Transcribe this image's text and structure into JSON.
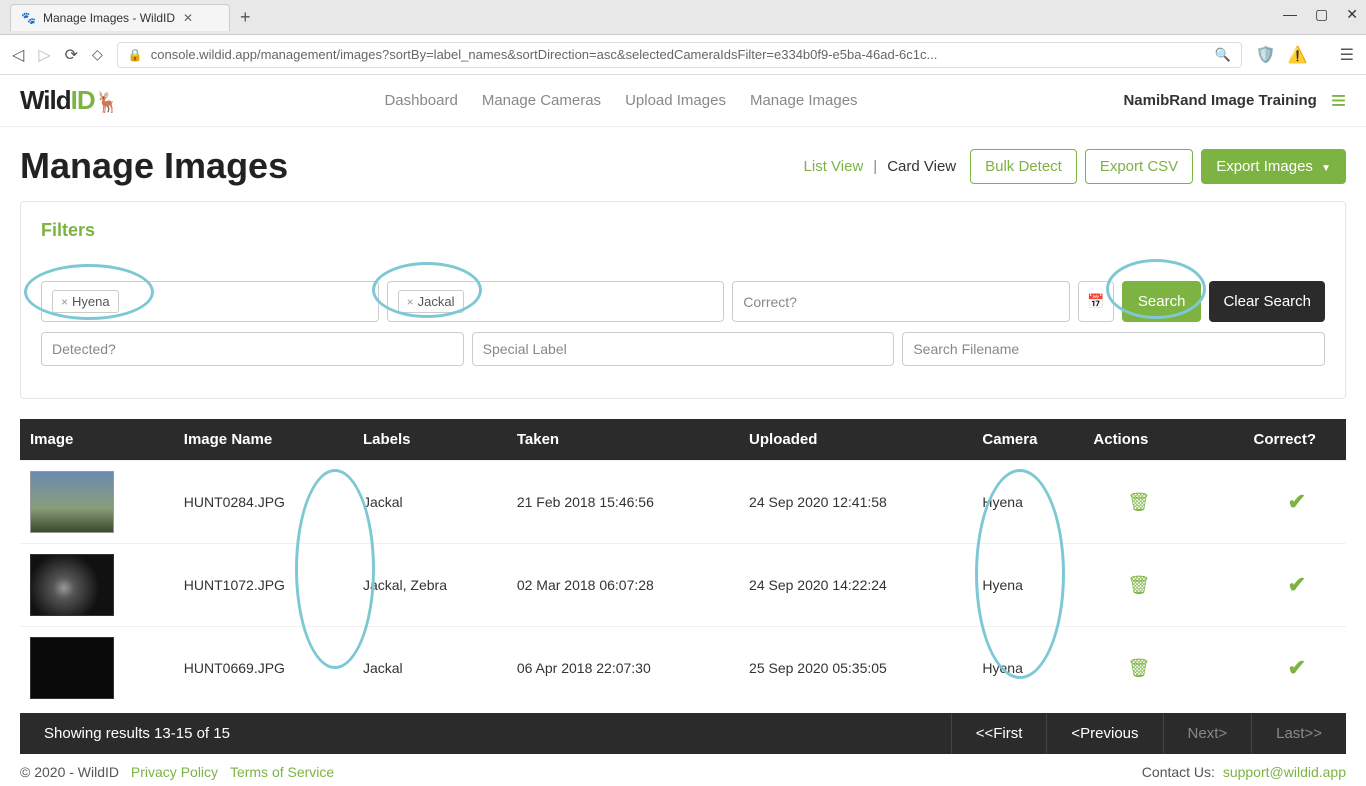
{
  "browser": {
    "tab_title": "Manage Images - WildID",
    "url": "console.wildid.app/management/images?sortBy=label_names&sortDirection=asc&selectedCameraIdsFilter=e334b0f9-e5ba-46ad-6c1c..."
  },
  "logo": {
    "part1": "Wild",
    "part2": "ID"
  },
  "nav": {
    "dashboard": "Dashboard",
    "manage_cameras": "Manage Cameras",
    "upload_images": "Upload Images",
    "manage_images": "Manage Images"
  },
  "account_label": "NamibRand Image Training",
  "page_title": "Manage Images",
  "view_toggle": {
    "list": "List View",
    "sep": "|",
    "card": "Card View"
  },
  "buttons": {
    "bulk_detect": "Bulk Detect",
    "export_csv": "Export CSV",
    "export_images": "Export Images"
  },
  "filters": {
    "heading": "Filters",
    "tag1": "Hyena",
    "tag2": "Jackal",
    "correct_placeholder": "Correct?",
    "detected_placeholder": "Detected?",
    "special_placeholder": "Special Label",
    "filename_placeholder": "Search Filename",
    "search": "Search",
    "clear": "Clear Search"
  },
  "columns": {
    "image": "Image",
    "name": "Image Name",
    "labels": "Labels",
    "taken": "Taken",
    "uploaded": "Uploaded",
    "camera": "Camera",
    "actions": "Actions",
    "correct": "Correct?"
  },
  "rows": [
    {
      "name": "HUNT0284.JPG",
      "labels": "Jackal",
      "taken": "21 Feb 2018 15:46:56",
      "uploaded": "24 Sep 2020 12:41:58",
      "camera": "Hyena"
    },
    {
      "name": "HUNT1072.JPG",
      "labels": "Jackal, Zebra",
      "taken": "02 Mar 2018 06:07:28",
      "uploaded": "24 Sep 2020 14:22:24",
      "camera": "Hyena"
    },
    {
      "name": "HUNT0669.JPG",
      "labels": "Jackal",
      "taken": "06 Apr 2018 22:07:30",
      "uploaded": "25 Sep 2020 05:35:05",
      "camera": "Hyena"
    }
  ],
  "pager": {
    "info": "Showing results 13-15 of 15",
    "first": "<<First",
    "prev": "<Previous",
    "next": "Next>",
    "last": "Last>>"
  },
  "footer": {
    "copyright": "© 2020 - WildID",
    "privacy": "Privacy Policy",
    "terms": "Terms of Service",
    "contact_label": "Contact Us:",
    "contact_email": "support@wildid.app"
  }
}
